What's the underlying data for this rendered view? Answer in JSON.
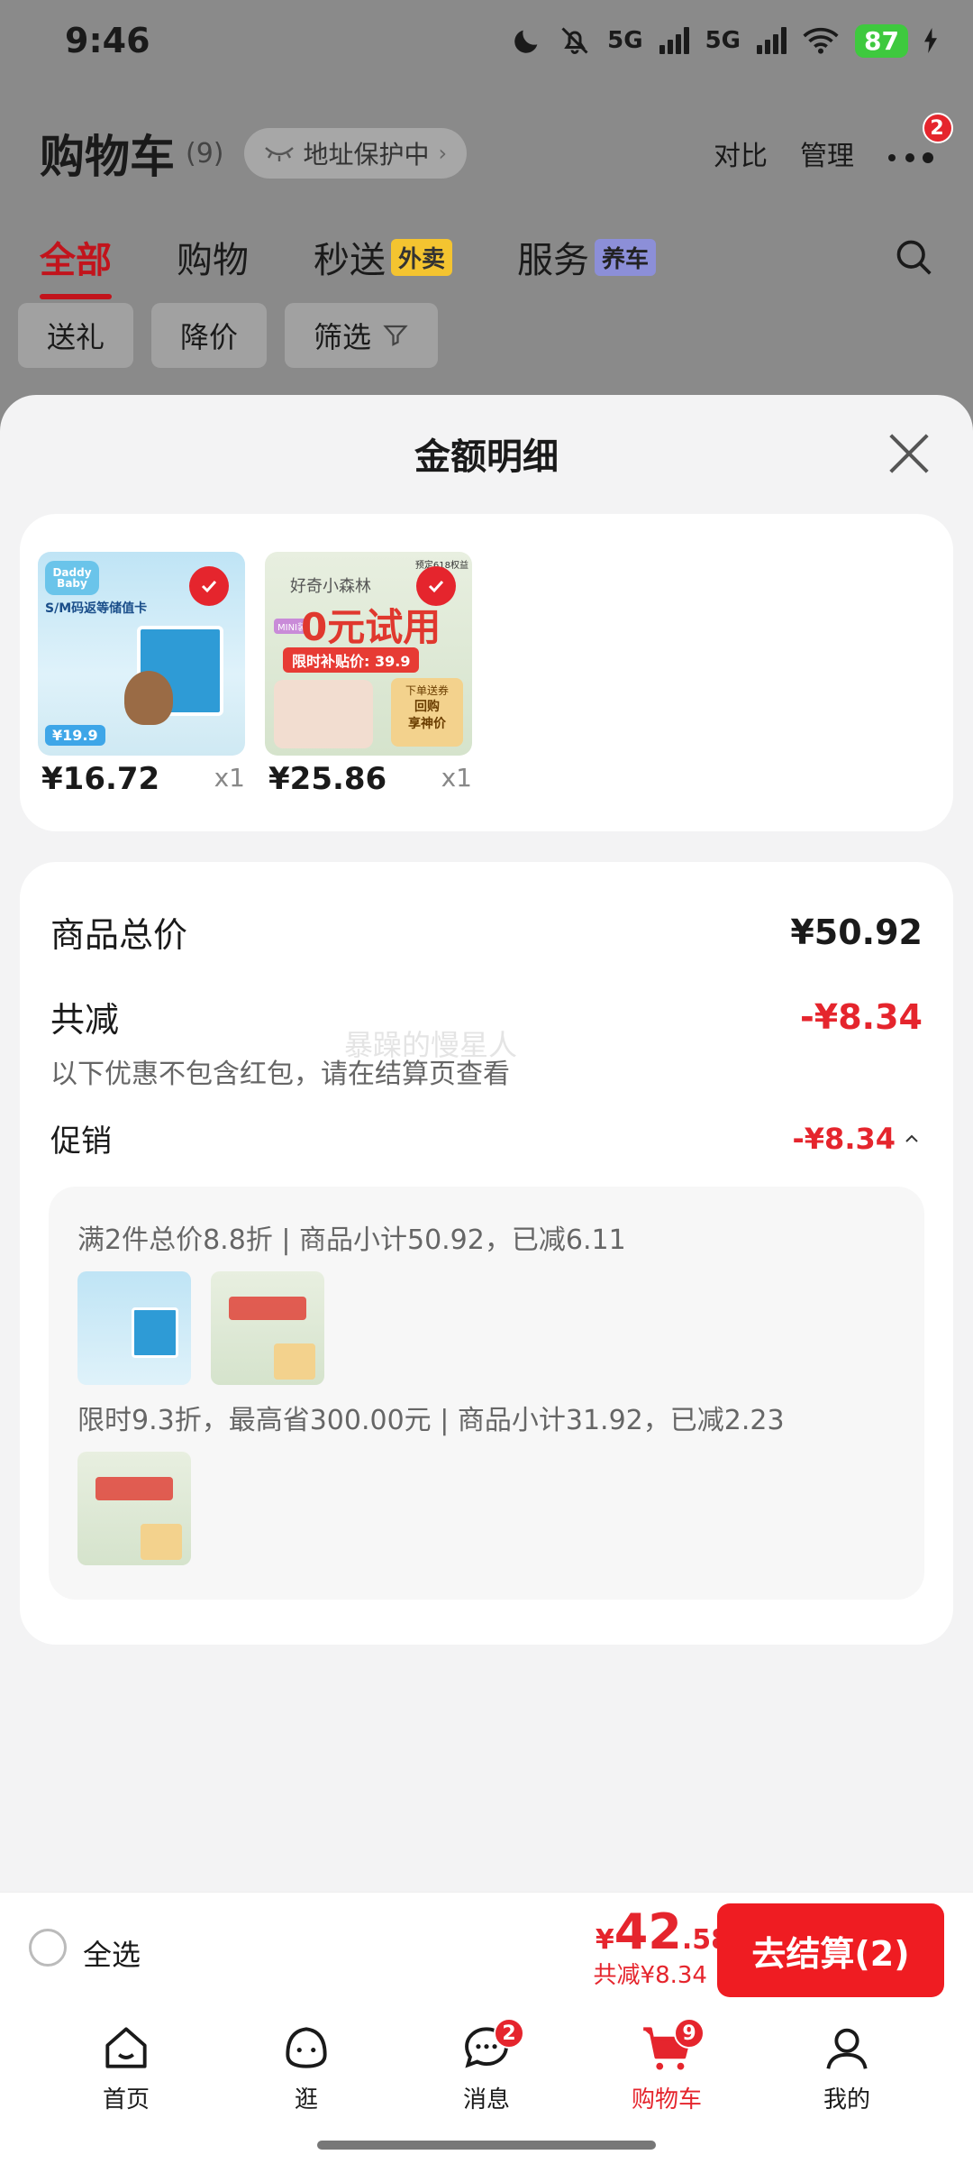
{
  "status": {
    "time": "9:46",
    "battery": "87",
    "net1": "5G",
    "net2": "5G"
  },
  "header": {
    "title": "购物车",
    "count": "(9)",
    "address_pill": "地址保护中",
    "compare": "对比",
    "manage": "管理",
    "more_badge": "2"
  },
  "tabs": [
    {
      "label": "全部"
    },
    {
      "label": "购物"
    },
    {
      "label": "秒送",
      "tag": "外卖"
    },
    {
      "label": "服务",
      "tag": "养车"
    }
  ],
  "filters": {
    "gift": "送礼",
    "price_drop": "降价",
    "filter": "筛选"
  },
  "sheet": {
    "title": "金额明细",
    "products": [
      {
        "price": "¥16.72",
        "qty": "x1"
      },
      {
        "price": "¥25.86",
        "qty": "x1"
      }
    ],
    "total_label": "商品总价",
    "total_value": "¥50.92",
    "reduce_label": "共减",
    "reduce_value": "-¥8.34",
    "reduce_note": "以下优惠不包含红包，请在结算页查看",
    "watermark": "暴躁的慢星人",
    "promo_label": "促销",
    "promo_value": "-¥8.34",
    "promo_rule1": "满2件总价8.8折 | 商品小计50.92，已减6.11",
    "promo_rule2": "限时9.3折，最高省300.00元 | 商品小计31.92，已减2.23",
    "img_text": {
      "p1_brand": "Daddy Baby",
      "p1_line": "S/M码返等储值卡",
      "p1_price": "¥19.9",
      "p2_brand": "好奇小森林",
      "p2_big": "0元试用",
      "p2_sub": "限时补贴价: 39.9",
      "p2_mini": "MINI装",
      "p2_note1": "下单送券",
      "p2_note2": "回购",
      "p2_note3": "享神价",
      "p2_top": "预定618权益"
    }
  },
  "bottom": {
    "select_all": "全选",
    "currency": "¥",
    "price_int": "42",
    "price_dec": ".58",
    "saved": "共减¥8.34",
    "checkout": "去结算(2)"
  },
  "nav": [
    {
      "label": "首页"
    },
    {
      "label": "逛"
    },
    {
      "label": "消息",
      "badge": "2"
    },
    {
      "label": "购物车",
      "badge": "9"
    },
    {
      "label": "我的"
    }
  ]
}
